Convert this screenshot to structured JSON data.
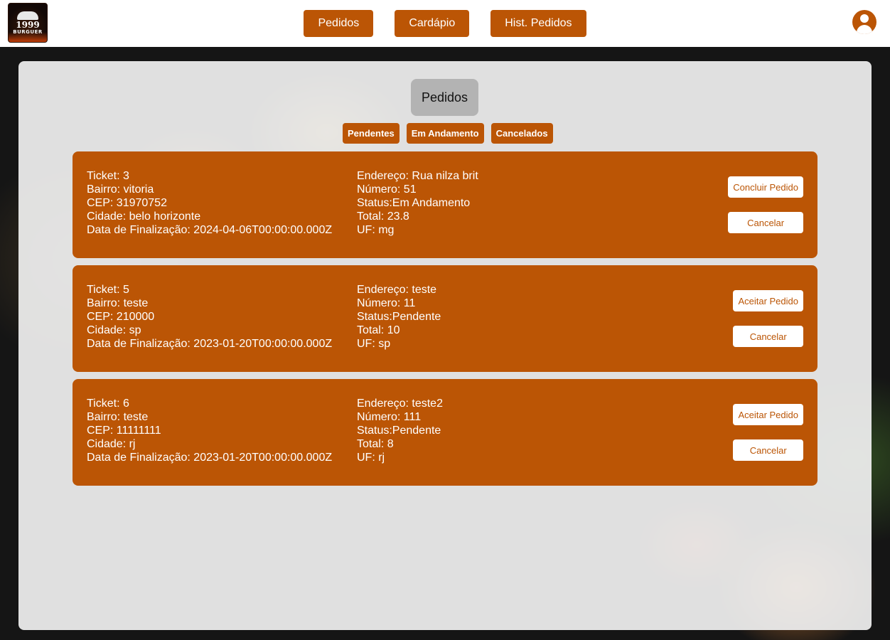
{
  "header": {
    "logo": {
      "number": "1999",
      "word": "BURGUER"
    },
    "nav": [
      "Pedidos",
      "Cardápio",
      "Hist. Pedidos"
    ],
    "avatar_icon": "user-circle-icon"
  },
  "panel": {
    "title": "Pedidos",
    "filters": [
      "Pendentes",
      "Em Andamento",
      "Cancelados"
    ]
  },
  "orders": [
    {
      "ticket": "Ticket: 3",
      "bairro": "Bairro: vitoria",
      "cep": "CEP: 31970752",
      "cidade": "Cidade: belo horizonte",
      "data": "Data de Finalização: 2024-04-06T00:00:00.000Z",
      "endereco": "Endereço: Rua nilza brit",
      "numero": "Número: 51",
      "status": "Status:Em Andamento",
      "total": "Total: 23.8",
      "uf": "UF: mg",
      "primary_action": "Concluir Pedido",
      "cancel_action": "Cancelar"
    },
    {
      "ticket": "Ticket: 5",
      "bairro": "Bairro: teste",
      "cep": "CEP: 210000",
      "cidade": "Cidade: sp",
      "data": "Data de Finalização: 2023-01-20T00:00:00.000Z",
      "endereco": "Endereço: teste",
      "numero": "Número: 11",
      "status": "Status:Pendente",
      "total": "Total: 10",
      "uf": "UF: sp",
      "primary_action": "Aceitar Pedido",
      "cancel_action": "Cancelar"
    },
    {
      "ticket": "Ticket: 6",
      "bairro": "Bairro: teste",
      "cep": "CEP: 11111111",
      "cidade": "Cidade: rj",
      "data": "Data de Finalização: 2023-01-20T00:00:00.000Z",
      "endereco": "Endereço: teste2",
      "numero": "Número: 111",
      "status": "Status:Pendente",
      "total": "Total: 8",
      "uf": "UF: rj",
      "primary_action": "Aceitar Pedido",
      "cancel_action": "Cancelar"
    }
  ],
  "colors": {
    "accent": "#bb5505",
    "panel": "#f0f0f0",
    "title_bg": "#b3b3b3"
  }
}
